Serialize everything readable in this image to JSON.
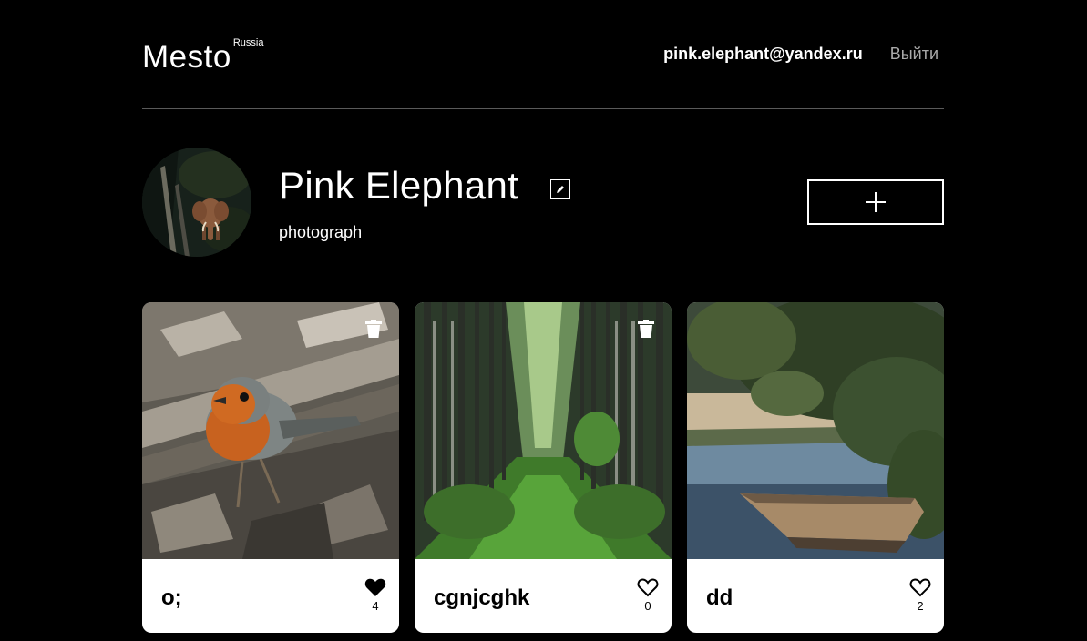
{
  "header": {
    "logo": "Mesto",
    "logo_sup": "Russia",
    "email": "pink.elephant@yandex.ru",
    "logout_label": "Выйти"
  },
  "profile": {
    "name": "Pink Elephant",
    "about": "photograph"
  },
  "icons": {
    "edit": "pencil-icon",
    "add": "plus-icon",
    "delete": "trash-icon",
    "like": "heart-icon"
  },
  "cards": [
    {
      "title": "o;",
      "likes": "4",
      "liked": true,
      "deletable": true
    },
    {
      "title": "cgnjcghk",
      "likes": "0",
      "liked": false,
      "deletable": true
    },
    {
      "title": "dd",
      "likes": "2",
      "liked": false,
      "deletable": false
    }
  ]
}
